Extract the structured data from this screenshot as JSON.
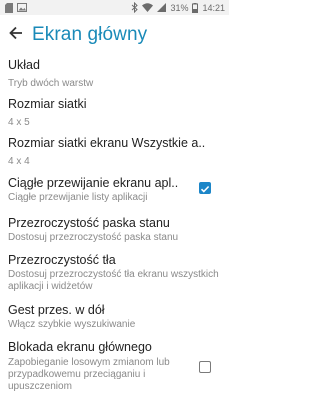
{
  "status_bar": {
    "battery": "31%",
    "time": "14:21"
  },
  "header": {
    "title": "Ekran główny"
  },
  "settings": [
    {
      "title": "Układ",
      "summary": "Tryb dwóch warstw"
    },
    {
      "title": "Rozmiar  siatki",
      "summary": "4 x 5"
    },
    {
      "title": "Rozmiar siatki ekranu Wszystkie a..",
      "summary": "4 x 4"
    },
    {
      "title": "Ciągłe przewijanie ekranu apl..",
      "summary": "Ciągłe przewijanie listy aplikacji",
      "checked": true
    },
    {
      "title": "Przezroczystość paska stanu",
      "summary": "Dostosuj przezroczystość paska stanu"
    },
    {
      "title": "Przezroczystość tła",
      "summary": "Dostosuj przezroczystość tła ekranu wszystkich aplikacji i widżetów"
    },
    {
      "title": "Gest przes. w dół",
      "summary": "Włącz szybkie wyszukiwanie"
    },
    {
      "title": "Blokada ekranu głównego",
      "summary": "Zapobieganie losowym zmianom lub przypadkowemu przeciąganiu i upuszczeniom",
      "checked": false
    }
  ],
  "colors": {
    "accent": "#1a8ab8",
    "checkbox_checked": "#1c86c8"
  }
}
